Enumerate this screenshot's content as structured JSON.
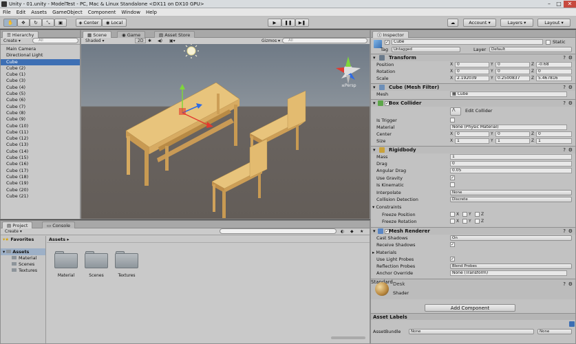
{
  "window": {
    "title": "Unity - 01.unity - ModelTest - PC, Mac & Linux Standalone <DX11 on DX10 GPU>"
  },
  "menu": [
    "File",
    "Edit",
    "Assets",
    "GameObject",
    "Component",
    "Window",
    "Help"
  ],
  "toolbar": {
    "pivot_center": "Center",
    "pivot_space": "Local",
    "account": "Account",
    "layers": "Layers",
    "layout": "Layout"
  },
  "hierarchy": {
    "tab": "Hierarchy",
    "create": "Create",
    "search_placeholder": "All",
    "items": [
      "Main Camera",
      "Directional Light",
      "Cube",
      "Cube (2)",
      "Cube (1)",
      "Cube (3)",
      "Cube (4)",
      "Cube (5)",
      "Cube (6)",
      "Cube (7)",
      "Cube (8)",
      "Cube (9)",
      "Cube (10)",
      "Cube (11)",
      "Cube (12)",
      "Cube (13)",
      "Cube (14)",
      "Cube (15)",
      "Cube (16)",
      "Cube (17)",
      "Cube (18)",
      "Cube (19)",
      "Cube (20)",
      "Cube (21)"
    ],
    "selected_index": 2
  },
  "scene": {
    "tabs": [
      "Scene",
      "Game",
      "Asset Store"
    ],
    "shading": "Shaded",
    "mode2d": "2D",
    "gizmos": "Gizmos",
    "search_placeholder": "All",
    "persp_label": "≤Persp"
  },
  "project": {
    "tabs": [
      "Project",
      "Console"
    ],
    "create": "Create",
    "favorites": "Favorites",
    "assets_root": "Assets",
    "breadcrumb": "Assets ▸",
    "tree": [
      "Material",
      "Scenes",
      "Textures"
    ],
    "folders": [
      "Material",
      "Scenes",
      "Textures"
    ]
  },
  "inspector": {
    "tab": "Inspector",
    "object_name": "Cube",
    "static_label": "Static",
    "tag_label": "Tag",
    "tag_value": "Untagged",
    "layer_label": "Layer",
    "layer_value": "Default",
    "transform": {
      "title": "Transform",
      "position": {
        "label": "Position",
        "x": "0",
        "y": "0",
        "z": "-0.68"
      },
      "rotation": {
        "label": "Rotation",
        "x": "0",
        "y": "0",
        "z": "0"
      },
      "scale": {
        "label": "Scale",
        "x": "2.192039",
        "y": "0.2500837",
        "z": "5.467816"
      }
    },
    "mesh_filter": {
      "title": "Cube (Mesh Filter)",
      "mesh_label": "Mesh",
      "mesh_value": "Cube"
    },
    "box_collider": {
      "title": "Box Collider",
      "edit_label": "Edit Collider",
      "is_trigger": "Is Trigger",
      "material_label": "Material",
      "material_value": "None (Physic Material)",
      "center": {
        "label": "Center",
        "x": "0",
        "y": "0",
        "z": "0"
      },
      "size": {
        "label": "Size",
        "x": "1",
        "y": "1",
        "z": "1"
      }
    },
    "rigidbody": {
      "title": "Rigidbody",
      "mass_label": "Mass",
      "mass": "1",
      "drag_label": "Drag",
      "drag": "0",
      "angular_drag_label": "Angular Drag",
      "angular_drag": "0.05",
      "use_gravity": "Use Gravity",
      "is_kinematic": "Is Kinematic",
      "interpolate_label": "Interpolate",
      "interpolate": "None",
      "collision_label": "Collision Detection",
      "collision": "Discrete",
      "constraints": "Constraints",
      "freeze_pos": "Freeze Position",
      "freeze_rot": "Freeze Rotation"
    },
    "mesh_renderer": {
      "title": "Mesh Renderer",
      "cast_shadows_label": "Cast Shadows",
      "cast_shadows": "On",
      "receive_shadows": "Receive Shadows",
      "materials": "Materials",
      "use_light_probes": "Use Light Probes",
      "reflection_label": "Reflection Probes",
      "reflection": "Blend Probes",
      "anchor_label": "Anchor Override",
      "anchor": "None (Transform)"
    },
    "material": {
      "name": "Desk",
      "shader_label": "Shader",
      "shader": "Standard"
    },
    "add_component": "Add Component",
    "asset_labels": "Asset Labels",
    "asset_bundle_label": "AssetBundle",
    "asset_bundle": "None",
    "asset_variant": "None",
    "axis_x": "X",
    "axis_y": "Y",
    "axis_z": "Z"
  }
}
